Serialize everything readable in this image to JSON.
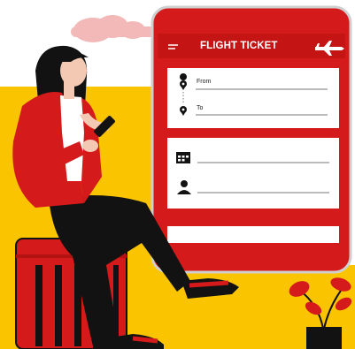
{
  "phone": {
    "title": "FLIGHT TICKET",
    "from_label": "From",
    "to_label": "To",
    "icons": [
      "menu-icon",
      "airplane-icon",
      "location-pin-icon",
      "calendar-icon",
      "person-icon"
    ]
  },
  "colors": {
    "primary_red": "#d41a1a",
    "dark_red": "#b31212",
    "yellow": "#fbc400",
    "cloud": "#f3b8b8",
    "ink": "#121212"
  }
}
